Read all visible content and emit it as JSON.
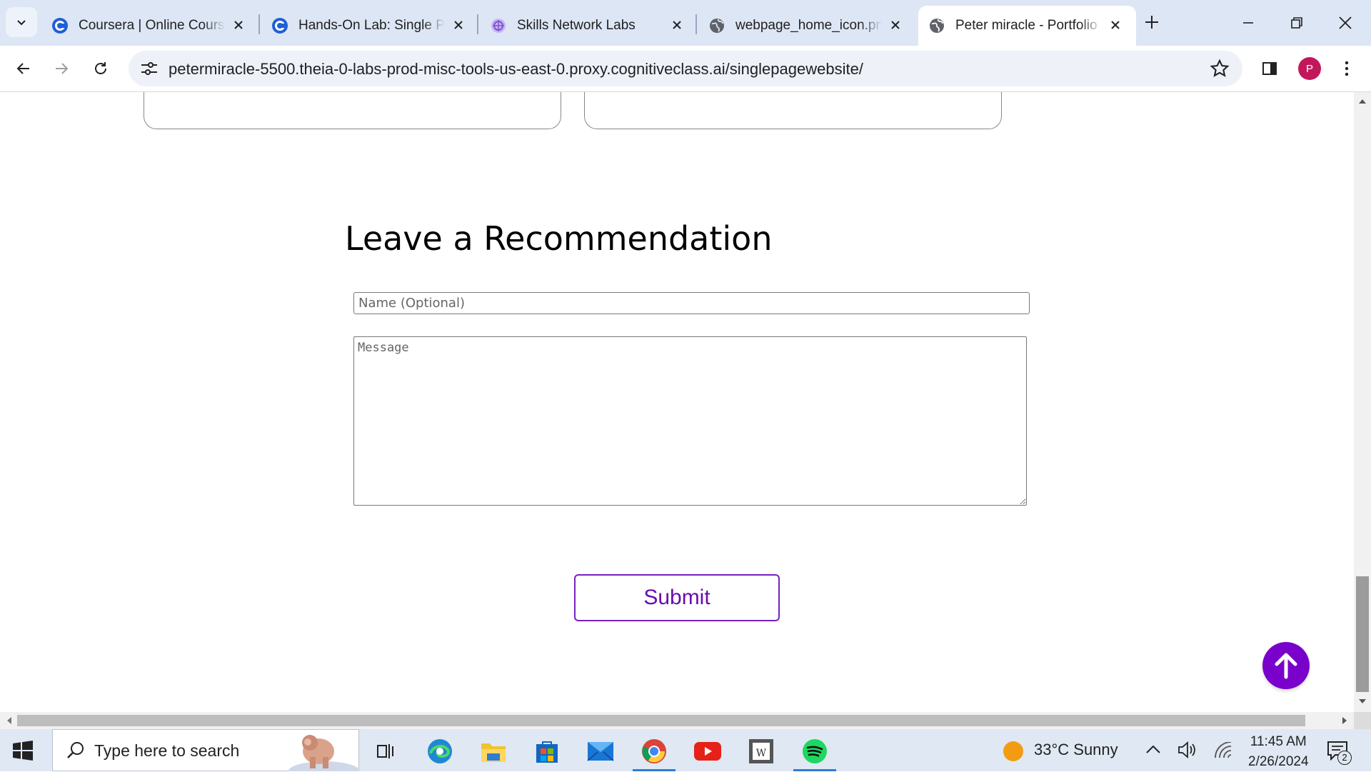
{
  "browser": {
    "tabs": [
      {
        "title": "Coursera | Online Courses",
        "favicon": "coursera-icon"
      },
      {
        "title": "Hands-On Lab: Single Page",
        "favicon": "coursera-icon"
      },
      {
        "title": "Skills Network Labs",
        "favicon": "skills-network-icon"
      },
      {
        "title": "webpage_home_icon.png",
        "favicon": "globe-icon"
      },
      {
        "title": "Peter miracle - Portfolio",
        "favicon": "globe-icon",
        "active": true
      }
    ],
    "url": "petermiracle-5500.theia-0-labs-prod-misc-tools-us-east-0.proxy.cognitiveclass.ai/singlepagewebsite/",
    "profile_initial": "P"
  },
  "page": {
    "heading": "Leave a Recommendation",
    "name_placeholder": "Name (Optional)",
    "message_placeholder": "Message",
    "submit_label": "Submit",
    "accent_color": "#7a00cc"
  },
  "taskbar": {
    "search_placeholder": "Type here to search",
    "weather": "33°C  Sunny",
    "time": "11:45 AM",
    "date": "2/26/2024",
    "notification_count": "2",
    "apps": [
      "task-view-icon",
      "edge-icon",
      "file-explorer-icon",
      "store-icon",
      "mail-icon",
      "chrome-icon",
      "youtube-icon",
      "wps-icon",
      "spotify-icon"
    ]
  }
}
